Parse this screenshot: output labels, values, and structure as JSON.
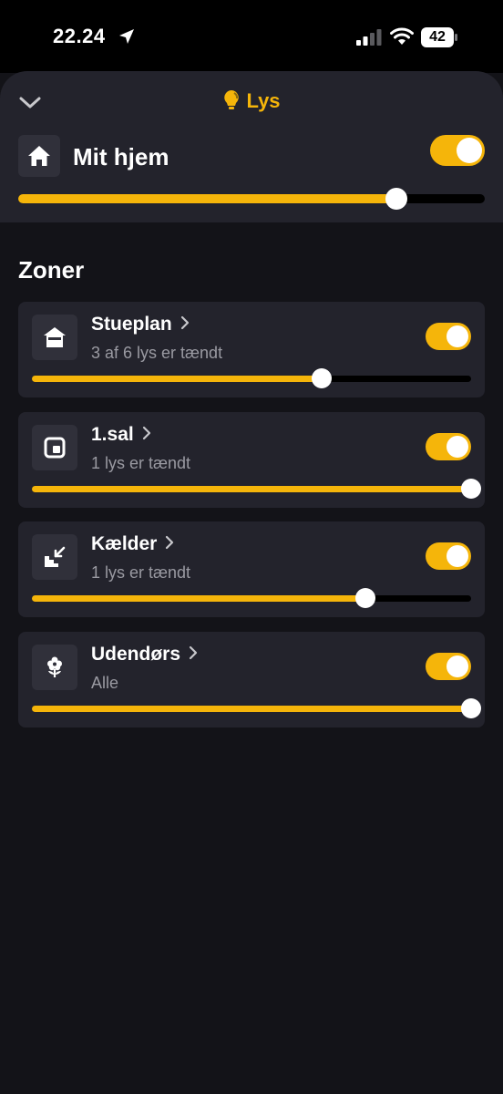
{
  "status_bar": {
    "time": "22.24",
    "battery": "42"
  },
  "header": {
    "title": "Lys"
  },
  "home": {
    "title": "Mit hjem",
    "toggle_on": true,
    "brightness": 0.81
  },
  "section": {
    "title": "Zoner"
  },
  "zones": [
    {
      "name": "Stueplan",
      "subtitle": "3 af 6 lys er tændt",
      "icon": "house-floor-icon",
      "toggle_on": true,
      "brightness": 0.66
    },
    {
      "name": "1.sal",
      "subtitle": "1 lys er tændt",
      "icon": "floor-plan-icon",
      "toggle_on": true,
      "brightness": 1.0
    },
    {
      "name": "Kælder",
      "subtitle": "1 lys er tændt",
      "icon": "stairs-down-icon",
      "toggle_on": true,
      "brightness": 0.76
    },
    {
      "name": "Udendørs",
      "subtitle": "Alle",
      "icon": "flower-icon",
      "toggle_on": true,
      "brightness": 1.0
    }
  ],
  "colors": {
    "accent": "#f5b50a",
    "card": "#23232c",
    "background": "#131318"
  }
}
